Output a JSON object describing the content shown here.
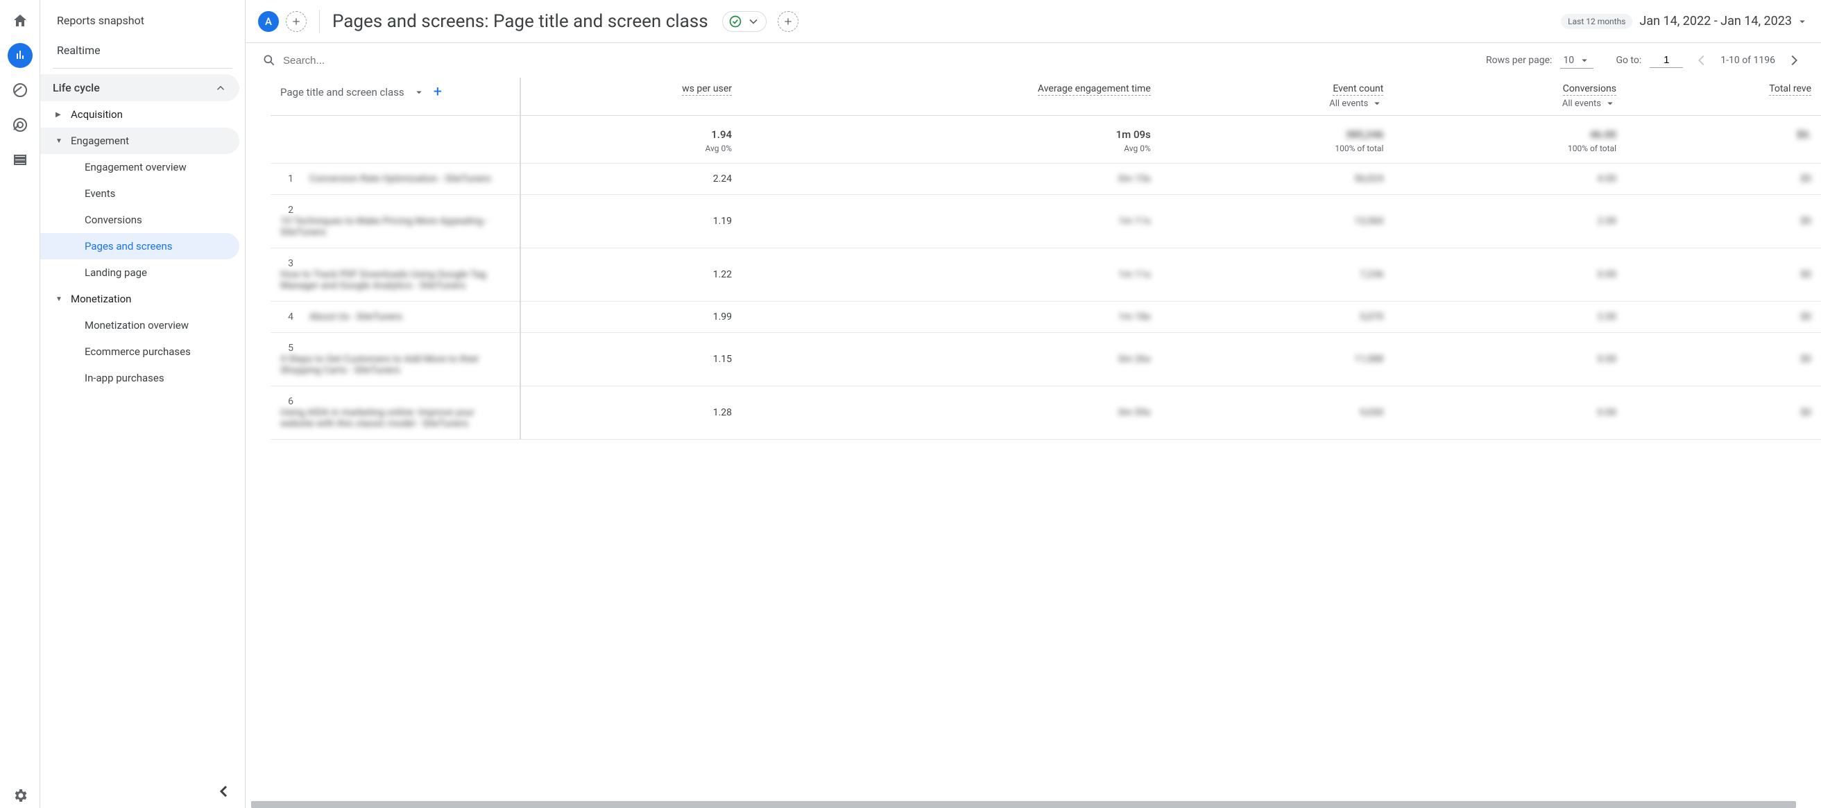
{
  "rail": {
    "icons": [
      "home",
      "reports",
      "explore",
      "advertising",
      "configure",
      "admin"
    ]
  },
  "sidebar": {
    "snapshot": "Reports snapshot",
    "realtime": "Realtime",
    "lifecycle": "Life cycle",
    "acquisition": "Acquisition",
    "engagement": "Engagement",
    "eng_overview": "Engagement overview",
    "events": "Events",
    "conversions": "Conversions",
    "pages_screens": "Pages and screens",
    "landing": "Landing page",
    "monetization": "Monetization",
    "mon_overview": "Monetization overview",
    "ecommerce": "Ecommerce purchases",
    "inapp": "In-app purchases"
  },
  "header": {
    "segment_letter": "A",
    "title": "Pages and screens: Page title and screen class",
    "date_label": "Last 12 months",
    "date_range": "Jan 14, 2022 - Jan 14, 2023"
  },
  "toolbar": {
    "search_placeholder": "Search...",
    "rows_label": "Rows per page:",
    "rows_value": "10",
    "goto_label": "Go to:",
    "goto_value": "1",
    "range_text": "1-10 of 1196"
  },
  "table": {
    "dim_label": "Page title and screen class",
    "cols": {
      "views_user": "ws per user",
      "avg_eng": "Average engagement time",
      "event_count": "Event count",
      "event_sub": "All events",
      "conversions": "Conversions",
      "conv_sub": "All events",
      "revenue": "Total reve"
    },
    "totals": {
      "views_user": "1.94",
      "views_user_sub": "Avg 0%",
      "avg_eng": "1m 09s",
      "avg_eng_sub": "Avg 0%",
      "event_count_sub": "100% of total",
      "conv_sub": "100% of total"
    },
    "rows": [
      {
        "idx": "1",
        "title": "Conversion Rate Optimization - SiteTuners",
        "views": "2.24",
        "eng": "0m 15s",
        "events": "56,024",
        "conv": "4.00",
        "rev": "$0"
      },
      {
        "idx": "2",
        "title": "10 Techniques to Make Pricing More Appealing - SiteTuners",
        "views": "1.19",
        "eng": "1m 11s",
        "events": "13,560",
        "conv": "2.00",
        "rev": "$0"
      },
      {
        "idx": "3",
        "title": "How to Track PDF Downloads Using Google Tag Manager and Google Analytics - SiteTuners",
        "views": "1.22",
        "eng": "1m 11s",
        "events": "7,236",
        "conv": "0.00",
        "rev": "$0"
      },
      {
        "idx": "4",
        "title": "About Us - SiteTuners",
        "views": "1.99",
        "eng": "1m 18s",
        "events": "5,070",
        "conv": "2.00",
        "rev": "$0"
      },
      {
        "idx": "5",
        "title": "4 Steps to Get Customers to Add More to their Shopping Carts - SiteTuners",
        "views": "1.15",
        "eng": "0m 26s",
        "events": "11,088",
        "conv": "0.00",
        "rev": "$0"
      },
      {
        "idx": "6",
        "title": "Using AIDA in marketing online: Improve your website with this classic model - SiteTuners",
        "views": "1.28",
        "eng": "0m 59s",
        "events": "9,030",
        "conv": "0.00",
        "rev": "$0"
      }
    ]
  }
}
